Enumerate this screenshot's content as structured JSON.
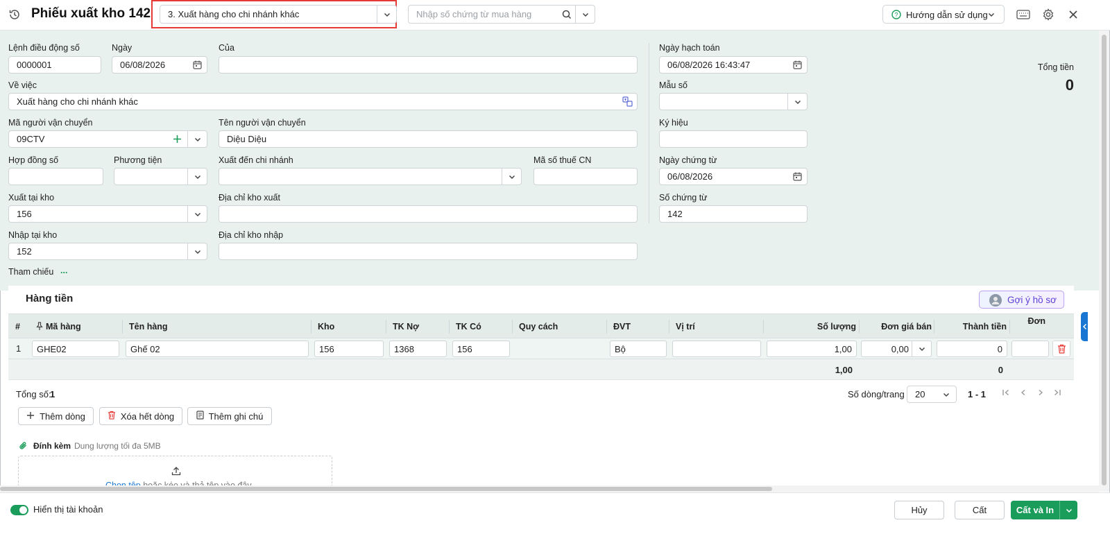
{
  "header": {
    "title": "Phiếu xuất kho 142",
    "type_select": "3. Xuất hàng cho chi nhánh khác",
    "search_placeholder": "Nhập số chứng từ mua hàng",
    "help_label": "Hướng dẫn sử dụng"
  },
  "form": {
    "lenh_dieu_dong_label": "Lệnh điều động số",
    "lenh_dieu_dong_value": "0000001",
    "ngay_label": "Ngày",
    "ngay_value": "06/08/2026",
    "cua_label": "Của",
    "cua_value": "",
    "ve_viec_label": "Về việc",
    "ve_viec_value": "Xuất hàng cho chi nhánh khác",
    "ma_nguoi_vc_label": "Mã người vận chuyển",
    "ma_nguoi_vc_value": "09CTV",
    "ten_nguoi_vc_label": "Tên người vận chuyển",
    "ten_nguoi_vc_value": "Diệu Diệu",
    "hop_dong_label": "Hợp đồng số",
    "phuong_tien_label": "Phương tiện",
    "xuat_den_cn_label": "Xuất đến chi nhánh",
    "ma_so_thue_label": "Mã số thuế CN",
    "xuat_tai_kho_label": "Xuất tại kho",
    "xuat_tai_kho_value": "156",
    "dia_chi_kho_xuat_label": "Địa chỉ kho xuất",
    "nhap_tai_kho_label": "Nhập tại kho",
    "nhap_tai_kho_value": "152",
    "dia_chi_kho_nhap_label": "Địa chỉ kho nhập",
    "tham_chieu_label": "Tham chiếu",
    "tham_chieu_more": "...",
    "ngay_hach_toan_label": "Ngày hạch toán",
    "ngay_hach_toan_value": "06/08/2026 16:43:47",
    "mau_so_label": "Mẫu số",
    "ky_hieu_label": "Ký hiệu",
    "ngay_chung_tu_label": "Ngày chứng từ",
    "ngay_chung_tu_value": "06/08/2026",
    "so_chung_tu_label": "Số chứng từ",
    "so_chung_tu_value": "142",
    "tong_tien_label": "Tổng tiền",
    "tong_tien_value": "0"
  },
  "grid": {
    "title": "Hàng tiền",
    "suggest_label": "Gợi ý hồ sơ",
    "columns": [
      "#",
      "Mã hàng",
      "Tên hàng",
      "Kho",
      "TK Nợ",
      "TK Có",
      "Quy cách",
      "ĐVT",
      "Vị trí",
      "Số lượng",
      "Đơn giá bán",
      "Thành tiền",
      "Đơn"
    ],
    "rows": [
      {
        "index": "1",
        "ma_hang": "GHE02",
        "ten_hang": "Ghế 02",
        "kho": "156",
        "tk_no": "1368",
        "tk_co": "156",
        "quy_cach": "",
        "dvt": "Bộ",
        "vi_tri": "",
        "so_luong": "1,00",
        "don_gia_ban": "0,00",
        "thanh_tien": "0"
      }
    ],
    "sum_so_luong": "1,00",
    "sum_thanh_tien": "0",
    "total_label": "Tổng số:",
    "total_value": "1",
    "rows_per_page_label": "Số dòng/trang",
    "rows_per_page_value": "20",
    "page_range": "1 - 1",
    "add_row_label": "Thêm dòng",
    "delete_all_label": "Xóa hết dòng",
    "add_note_label": "Thêm ghi chú"
  },
  "attachment": {
    "label": "Đính kèm",
    "limit": "Dung lượng tối đa 5MB",
    "choose_link": "Chọn tệp",
    "drop_text": "hoặc kéo và thả tệp vào đây"
  },
  "footer": {
    "show_account_label": "Hiển thị tài khoản",
    "cancel_label": "Hủy",
    "save_label": "Cất",
    "save_print_label": "Cất và In"
  },
  "colors": {
    "accent_green": "#1a9c5a",
    "form_bg": "#e9f1ef",
    "highlight_red": "#e53935",
    "delete_red": "#e53935",
    "suggest_purple": "#7b3fe4"
  }
}
